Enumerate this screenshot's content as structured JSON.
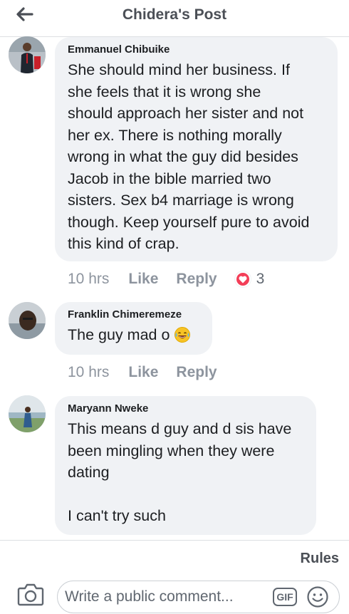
{
  "header": {
    "title": "Chidera's Post",
    "back_icon": "arrow-left-icon"
  },
  "comments": [
    {
      "author": "Emmanuel Chibuike",
      "text_lines": [
        "She should mind her business. If",
        "she feels that it is wrong she",
        "should approach her sister and not",
        "her ex. There is nothing morally",
        "wrong in what the guy did besides",
        "Jacob in the bible married two",
        "sisters. Sex b4 marriage is wrong",
        "though. Keep yourself pure to avoid",
        "this kind of crap."
      ],
      "time": "10 hrs",
      "like_label": "Like",
      "reply_label": "Reply",
      "reaction_icon": "heart-icon",
      "reaction_count": "3"
    },
    {
      "author": "Franklin Chimeremeze",
      "text_lines": [
        "The guy mad o"
      ],
      "emoji_icon": "laughing-tears-emoji",
      "time": "10 hrs",
      "like_label": "Like",
      "reply_label": "Reply"
    },
    {
      "author": "Maryann Nweke",
      "text_lines": [
        "This means d guy and d sis have",
        "been mingling when they were",
        "dating",
        "",
        "I can't try such"
      ]
    }
  ],
  "footer": {
    "rules_label": "Rules",
    "comment_placeholder": "Write a public comment...",
    "gif_label": "GIF",
    "camera_icon": "camera-icon",
    "emoji_icon": "smiley-icon"
  },
  "colors": {
    "bubble_bg": "#f0f2f5",
    "meta_text": "#8d949e",
    "heart": "#f33e58",
    "title_text": "#4b4f56"
  }
}
